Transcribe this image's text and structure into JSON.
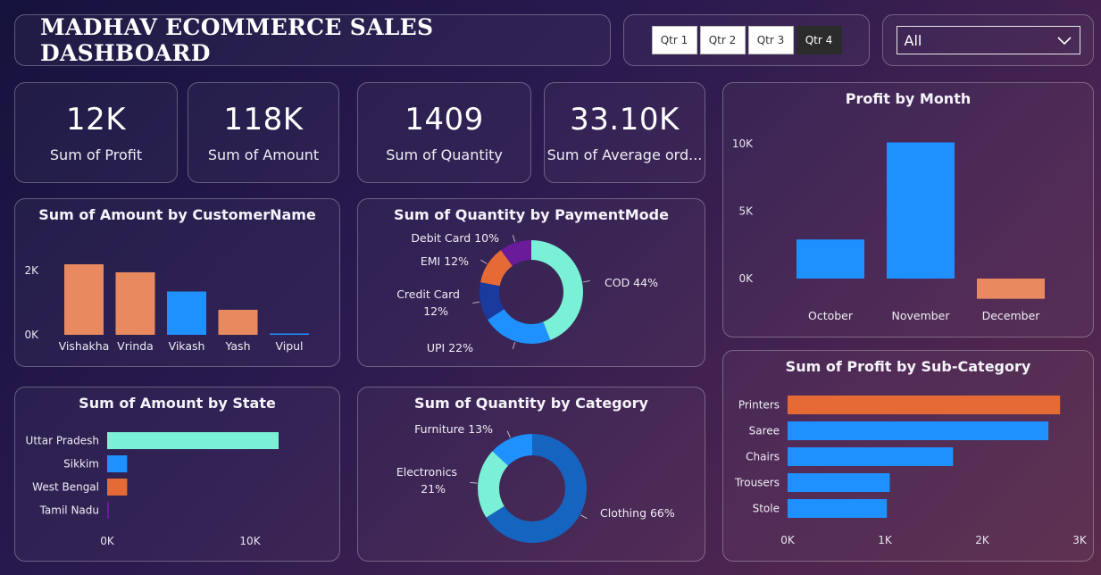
{
  "header": {
    "title": "MADHAV ECOMMERCE SALES DASHBOARD"
  },
  "quarters": {
    "q1": "Qtr 1",
    "q2": "Qtr 2",
    "q3": "Qtr 3",
    "q4": "Qtr 4",
    "selected": "Qtr 4"
  },
  "filter": {
    "value": "All"
  },
  "kpis": {
    "profit": {
      "value": "12K",
      "label": "Sum of Profit"
    },
    "amount": {
      "value": "118K",
      "label": "Sum of Amount"
    },
    "quantity": {
      "value": "1409",
      "label": "Sum of Quantity"
    },
    "avg_order": {
      "value": "33.10K",
      "label": "Sum of Average ord..."
    }
  },
  "colors": {
    "orange": "#E8895F",
    "blue": "#1E90FF",
    "teal": "#7AF0D6",
    "darkblue": "#1A3A9E",
    "purple": "#6A1B9A",
    "orange2": "#E66A35",
    "navy": "#1565C0"
  },
  "chart_data": [
    {
      "type": "bar",
      "title": "Sum of Amount by CustomerName",
      "categories": [
        "Vishakha",
        "Vrinda",
        "Vikash",
        "Yash",
        "Vipul"
      ],
      "values": [
        2200,
        1950,
        1350,
        780,
        20
      ],
      "colors": [
        "#E8895F",
        "#E8895F",
        "#1E90FF",
        "#E8895F",
        "#1E90FF"
      ],
      "ylim": [
        0,
        2700
      ],
      "yticks": [
        "0K",
        "2K"
      ]
    },
    {
      "type": "pie",
      "title": "Sum of Quantity by PaymentMode",
      "labels": [
        "COD 44%",
        "UPI 22%",
        "Credit Card 12%",
        "EMI 12%",
        "Debit Card 10%"
      ],
      "values": [
        44,
        22,
        12,
        12,
        10
      ],
      "colors": [
        "#7AF0D6",
        "#1E90FF",
        "#1A3A9E",
        "#E66A35",
        "#6A1B9A"
      ]
    },
    {
      "type": "bar",
      "title": "Profit by Month",
      "categories": [
        "October",
        "November",
        "December"
      ],
      "values": [
        2900,
        10100,
        -1500
      ],
      "colors": [
        "#1E90FF",
        "#1E90FF",
        "#E8895F"
      ],
      "ylim": [
        -2000,
        11000
      ],
      "yticks": [
        "10K",
        "5K",
        "0K"
      ]
    },
    {
      "type": "bar",
      "title": "Sum of Amount by State",
      "categories": [
        "Uttar Pradesh",
        "Sikkim",
        "West Bengal",
        "Tamil Nadu"
      ],
      "values": [
        12000,
        1400,
        1400,
        100
      ],
      "colors": [
        "#7AF0D6",
        "#1E90FF",
        "#E66A35",
        "#6A1B9A"
      ],
      "xlim": [
        0,
        12500
      ],
      "xticks": [
        "0K",
        "10K"
      ]
    },
    {
      "type": "pie",
      "title": "Sum of Quantity by Category",
      "labels": [
        "Clothing 66%",
        "Electronics 21%",
        "Furniture 13%"
      ],
      "values": [
        66,
        21,
        13
      ],
      "colors": [
        "#1565C0",
        "#7AF0D6",
        "#1E90FF"
      ]
    },
    {
      "type": "bar",
      "title": "Sum of Profit by Sub-Category",
      "categories": [
        "Printers",
        "Saree",
        "Chairs",
        "Trousers",
        "Stole"
      ],
      "values": [
        2800,
        2680,
        1700,
        1050,
        1020
      ],
      "colors": [
        "#E66A35",
        "#1E90FF",
        "#1E90FF",
        "#1E90FF",
        "#1E90FF"
      ],
      "xlim": [
        0,
        3000
      ],
      "xticks": [
        "0K",
        "1K",
        "2K",
        "3K"
      ]
    }
  ]
}
